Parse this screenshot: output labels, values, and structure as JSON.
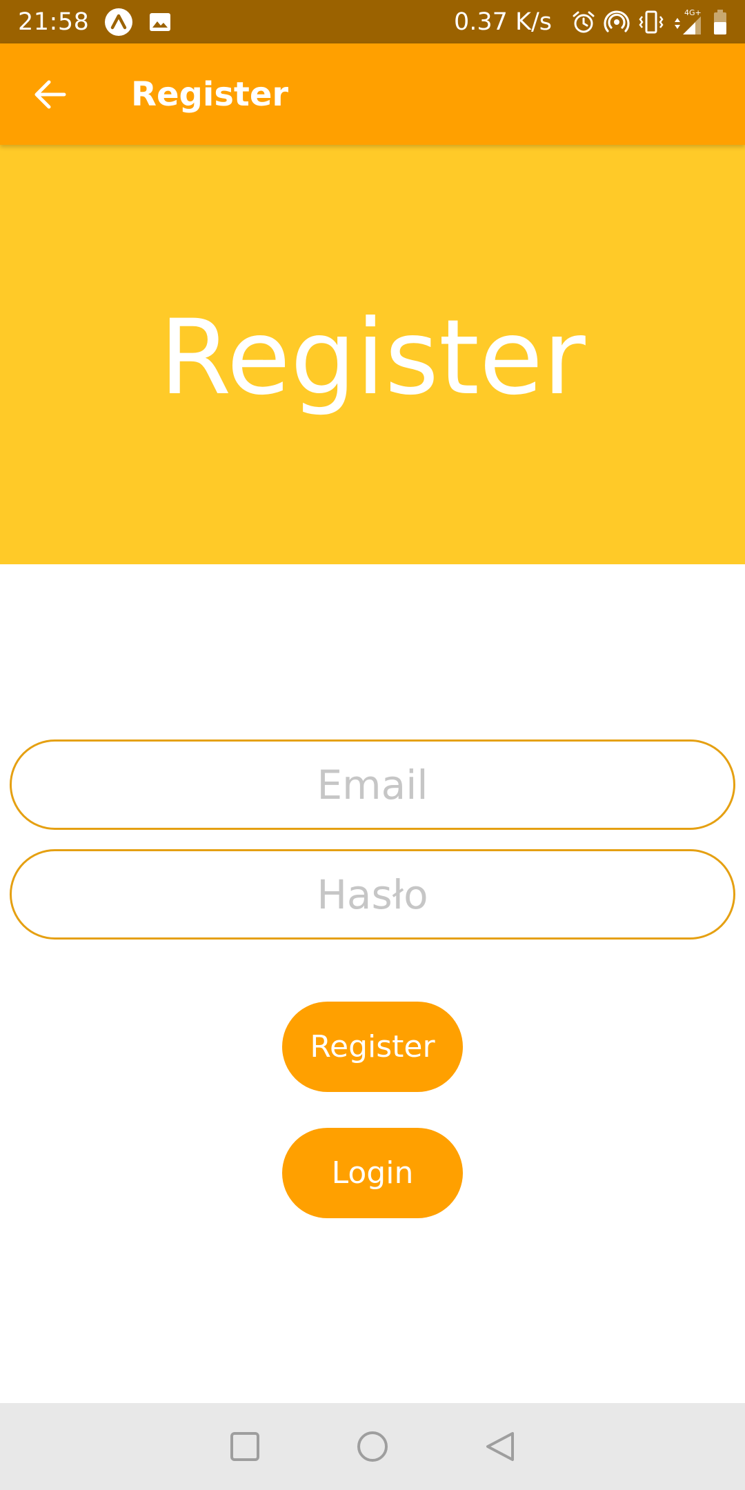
{
  "status_bar": {
    "time": "21:58",
    "speed": "0.37 K/s",
    "network": "4G+"
  },
  "app_bar": {
    "title": "Register"
  },
  "hero": {
    "title": "Register"
  },
  "form": {
    "email_placeholder": "Email",
    "password_placeholder": "Hasło",
    "register_label": "Register",
    "login_label": "Login"
  },
  "colors": {
    "status_bar": "#9B6200",
    "app_bar": "#FFA000",
    "hero": "#FFCA28",
    "input_border": "#E5A012",
    "nav_bar": "#E8E8E8"
  }
}
